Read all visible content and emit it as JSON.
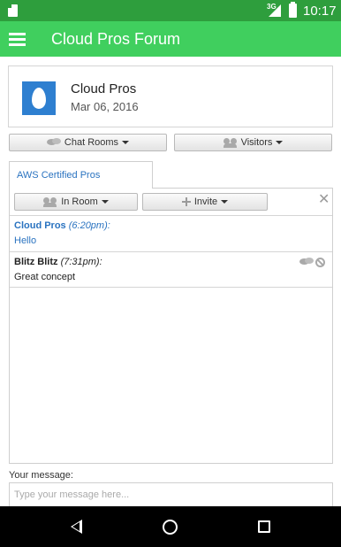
{
  "status_bar": {
    "network": "3G",
    "time": "10:17",
    "icons": [
      "sd-card-icon",
      "signal-icon",
      "battery-icon"
    ]
  },
  "app_bar": {
    "title": "Cloud Pros Forum",
    "menu_icon": "hamburger-menu-icon",
    "color": "#40cf5e"
  },
  "profile": {
    "name": "Cloud Pros",
    "date": "Mar 06, 2016",
    "logo_color": "#2e7fd0"
  },
  "toolbar": {
    "chat_rooms_label": "Chat Rooms",
    "visitors_label": "Visitors"
  },
  "tabs": [
    {
      "label": "AWS Certified Pros",
      "active": true
    }
  ],
  "room_toolbar": {
    "in_room_label": "In Room",
    "invite_label": "Invite",
    "close_glyph": "✕"
  },
  "messages": [
    {
      "author": "Cloud Pros",
      "time": "(6:20pm)",
      "sep": ":",
      "text": "Hello"
    },
    {
      "author": "Blitz Blitz",
      "time": "(7:31pm)",
      "sep": ":",
      "text": "Great concept"
    }
  ],
  "composer": {
    "label": "Your message:",
    "placeholder": "Type your message here..."
  },
  "accent_link_color": "#2a73c0"
}
